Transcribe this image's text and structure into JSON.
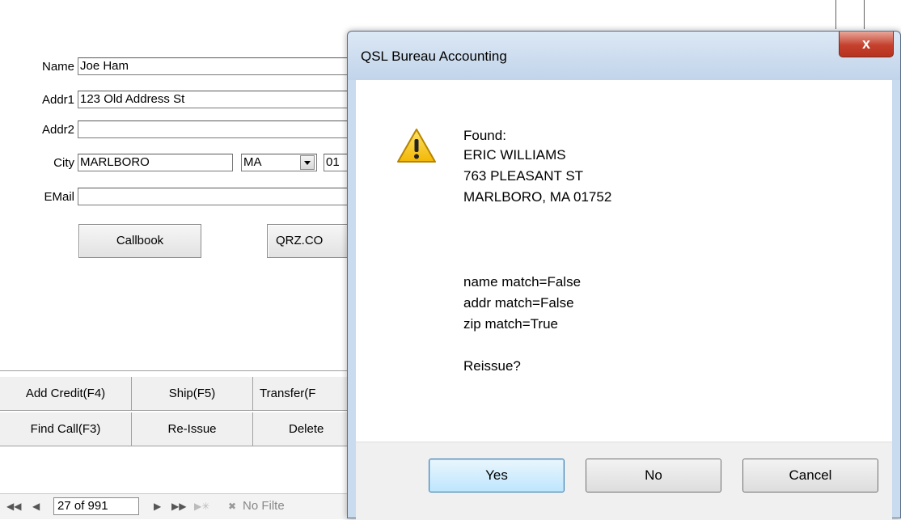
{
  "form": {
    "labels": {
      "name": "Name",
      "addr1": "Addr1",
      "addr2": "Addr2",
      "city": "City",
      "email": "EMail"
    },
    "values": {
      "name": "Joe Ham",
      "addr1": "123 Old Address St",
      "addr2": "",
      "city": "MARLBORO",
      "state": "MA",
      "zip_partial": "01",
      "email": ""
    },
    "buttons": {
      "callbook": "Callbook",
      "qrz": "QRZ.CO"
    }
  },
  "toolbar": {
    "row1": [
      "Add Credit(F4)",
      "Ship(F5)",
      "Transfer(F"
    ],
    "row2": [
      "Find Call(F3)",
      "Re-Issue",
      "Delete"
    ]
  },
  "nav": {
    "record": "27 of 991",
    "filter": "No Filte"
  },
  "dialog": {
    "title": "QSL Bureau Accounting",
    "close_glyph": "x",
    "message": {
      "found": "Found:",
      "name": "ERIC WILLIAMS",
      "street": "763 PLEASANT ST",
      "citystate": "MARLBORO, MA 01752",
      "name_match": "name match=False",
      "addr_match": "addr match=False",
      "zip_match": "zip match=True",
      "question": "Reissue?"
    },
    "buttons": {
      "yes": "Yes",
      "no": "No",
      "cancel": "Cancel"
    }
  },
  "icons": {
    "dialog_icon": "warning-icon",
    "dialog_close": "close-icon"
  },
  "colors": {
    "close_button": "#c4402c",
    "dialog_frame": "#c9dbee",
    "warning_yellow": "#f5c518"
  }
}
